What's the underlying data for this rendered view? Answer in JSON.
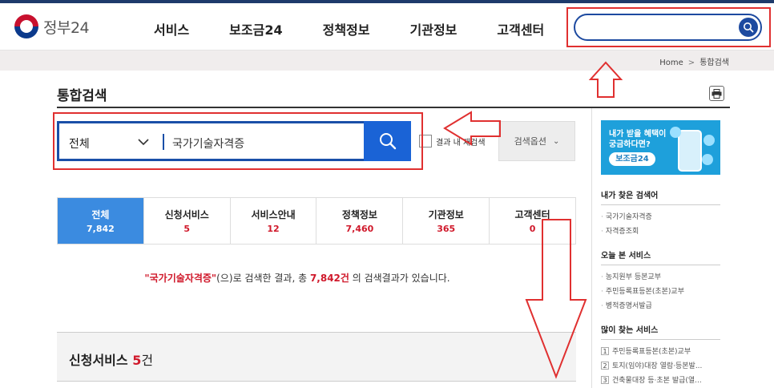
{
  "header": {
    "logo_text": "정부24",
    "nav": [
      "서비스",
      "보조금24",
      "정책정보",
      "기관정보",
      "고객센터"
    ]
  },
  "breadcrumb": {
    "home": "Home",
    "current": "통합검색"
  },
  "page_title": "통합검색",
  "search": {
    "scope": "전체",
    "value": "국가기술자격증",
    "re_search_label": "결과 내 재검색",
    "options_label": "검색옵션"
  },
  "tabs": [
    {
      "label": "전체",
      "count": "7,842",
      "active": true
    },
    {
      "label": "신청서비스",
      "count": "5"
    },
    {
      "label": "서비스안내",
      "count": "12"
    },
    {
      "label": "정책정보",
      "count": "7,460"
    },
    {
      "label": "기관정보",
      "count": "365"
    },
    {
      "label": "고객센터",
      "count": "0"
    }
  ],
  "result_message": {
    "keyword": "\"국가기술자격증\"",
    "part1": "(으)로 검색한 결과, 총 ",
    "total": "7,842건",
    "part2": " 의 검색결과가 있습니다."
  },
  "section": {
    "title": "신청서비스",
    "count": "5",
    "unit": "건"
  },
  "sidebar": {
    "banner": {
      "line1": "내가 받을 혜택이",
      "line2": "궁금하다면?",
      "pill": "보조금24"
    },
    "my_searches": {
      "title": "내가 찾은 검색어",
      "items": [
        "국가기술자격증",
        "자격증조회"
      ]
    },
    "today_services": {
      "title": "오늘 본 서비스",
      "items": [
        "농지원부 등본교부",
        "주민등록표등본(초본)교부",
        "병적증명서발급"
      ]
    },
    "popular_services": {
      "title": "많이 찾는 서비스",
      "items": [
        "주민등록표등본(초본)교부",
        "토지(임야)대장 열람·등본발...",
        "건축물대장 등·초본 발급(열..."
      ]
    }
  },
  "colors": {
    "accent": "#1a63d6",
    "highlight": "#d0192b",
    "annotation": "#e03030",
    "active_tab": "#3b8be0"
  }
}
